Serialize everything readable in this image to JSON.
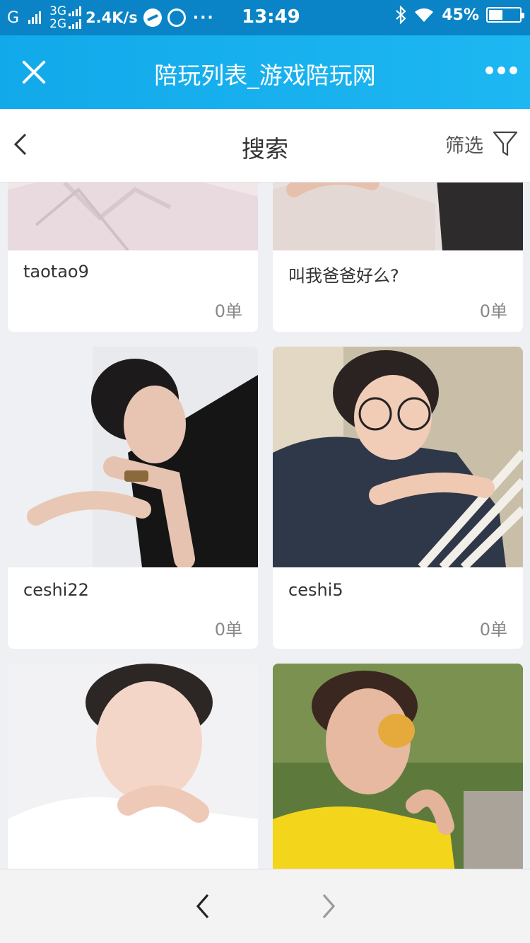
{
  "status_bar": {
    "carrier_g": "G",
    "net_3g": "3G",
    "net_2g": "2G",
    "speed": "2.4K/s",
    "more": "···",
    "time": "13:49",
    "battery_text": "45%",
    "battery_level": 0.45
  },
  "browser": {
    "title": "陪玩列表_游戏陪玩网"
  },
  "header": {
    "title": "搜索",
    "filter_label": "筛选"
  },
  "cards": [
    {
      "name": "taotao9",
      "orders": "0单"
    },
    {
      "name": "叫我爸爸好么?",
      "orders": "0单"
    },
    {
      "name": "ceshi22",
      "orders": "0单"
    },
    {
      "name": "ceshi5",
      "orders": "0单"
    },
    {
      "name": "",
      "orders": ""
    },
    {
      "name": "",
      "orders": ""
    }
  ],
  "colors": {
    "status_bar_bg": "#0a84c6",
    "browser_bar_bg": "#14aeee",
    "page_bg": "#eef0f3"
  }
}
